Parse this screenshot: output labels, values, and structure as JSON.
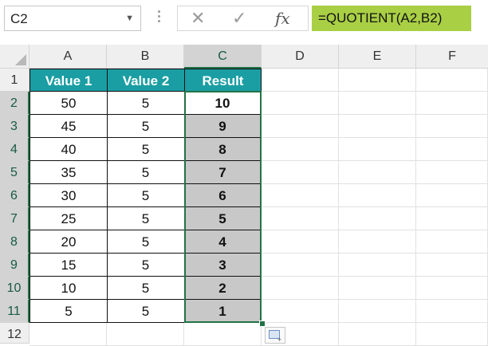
{
  "formula_bar": {
    "name_box": "C2",
    "cancel_icon": "close-icon",
    "enter_icon": "check-icon",
    "fx_label": "fx",
    "formula": "=QUOTIENT(A2,B2)"
  },
  "columns": [
    "A",
    "B",
    "C",
    "D",
    "E",
    "F"
  ],
  "rows": [
    "1",
    "2",
    "3",
    "4",
    "5",
    "6",
    "7",
    "8",
    "9",
    "10",
    "11",
    "12"
  ],
  "table": {
    "headers": [
      "Value 1",
      "Value 2",
      "Result"
    ],
    "data": [
      [
        "50",
        "5",
        "10"
      ],
      [
        "45",
        "5",
        "9"
      ],
      [
        "40",
        "5",
        "8"
      ],
      [
        "35",
        "5",
        "7"
      ],
      [
        "30",
        "5",
        "6"
      ],
      [
        "25",
        "5",
        "5"
      ],
      [
        "20",
        "5",
        "4"
      ],
      [
        "15",
        "5",
        "3"
      ],
      [
        "10",
        "5",
        "2"
      ],
      [
        "5",
        "5",
        "1"
      ]
    ]
  },
  "colors": {
    "header_fill": "#1a9ea3",
    "result_fill": "#c8c8c8",
    "formula_highlight": "#a9cf45",
    "selection": "#217346"
  }
}
